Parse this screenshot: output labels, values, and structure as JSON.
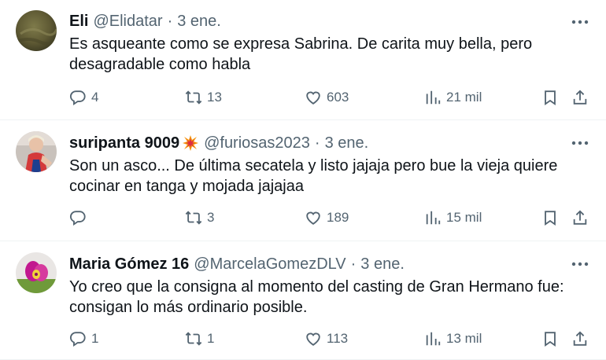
{
  "tweets": [
    {
      "name": "Eli",
      "handle": "@Elidatar",
      "separator": "·",
      "date": "3 ene.",
      "text": "Es asqueante como se expresa Sabrina. De carita muy bella, pero desagradable como habla",
      "replies": "4",
      "retweets": "13",
      "likes": "603",
      "views": "21 mil"
    },
    {
      "name": "suripanta 9009",
      "handle": "@furiosas2023",
      "separator": "·",
      "date": "3 ene.",
      "text": "Son un asco... De última secatela y listo jajaja pero bue la vieja quiere cocinar en tanga y mojada jajajaa",
      "replies": "",
      "retweets": "3",
      "likes": "189",
      "views": "15 mil"
    },
    {
      "name": "Maria Gómez 16",
      "handle": "@MarcelaGomezDLV",
      "separator": "·",
      "date": "3 ene.",
      "text": "Yo creo que la consigna al momento del casting de Gran Hermano fue: consigan lo más ordinario posible.",
      "replies": "1",
      "retweets": "1",
      "likes": "113",
      "views": "13 mil"
    }
  ],
  "icons": {
    "more": "more-horizontal-icon",
    "reply": "reply-icon",
    "retweet": "retweet-icon",
    "like": "heart-icon",
    "views": "views-bar-chart-icon",
    "bookmark": "bookmark-icon",
    "share": "share-icon",
    "name_emoji": "collision-emoji-icon"
  },
  "colors": {
    "text": "#0f1419",
    "secondary": "#536471",
    "divider": "#eff3f4"
  }
}
